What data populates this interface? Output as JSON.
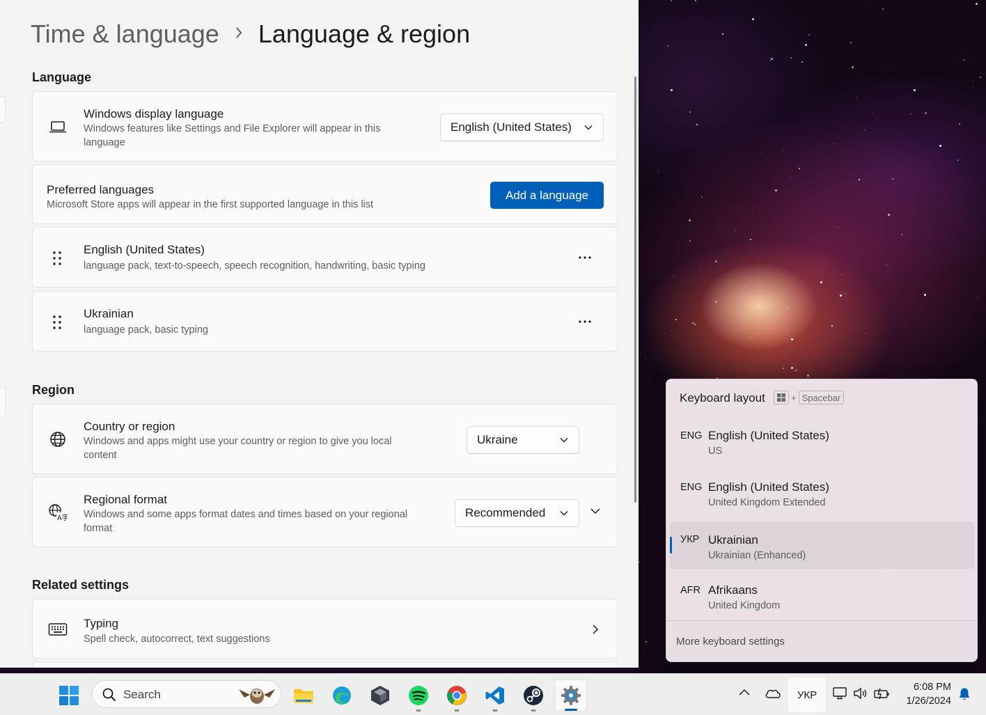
{
  "breadcrumb": {
    "parent": "Time & language",
    "current": "Language & region"
  },
  "language_section": {
    "title": "Language",
    "display_language": {
      "title": "Windows display language",
      "description_line1": "Windows features like Settings and File Explorer will appear in this",
      "description_line2": "language",
      "value": "English (United States)",
      "icon": "laptop-icon"
    },
    "preferred": {
      "title": "Preferred languages",
      "description": "Microsoft Store apps will appear in the first supported language in this list",
      "button": "Add a language"
    },
    "languages": [
      {
        "name": "English (United States)",
        "features": "language pack, text-to-speech, speech recognition, handwriting, basic typing"
      },
      {
        "name": "Ukrainian",
        "features": "language pack, basic typing"
      }
    ]
  },
  "region_section": {
    "title": "Region",
    "country": {
      "title": "Country or region",
      "description_line1": "Windows and apps might use your country or region to give you local",
      "description_line2": "content",
      "value": "Ukraine",
      "icon": "globe-icon"
    },
    "format": {
      "title": "Regional format",
      "description_line1": "Windows and some apps format dates and times based on your regional",
      "description_line2": "format",
      "value": "Recommended",
      "icon": "regional-format-icon"
    }
  },
  "related_section": {
    "title": "Related settings",
    "typing": {
      "title": "Typing",
      "description": "Spell check, autocorrect, text suggestions",
      "icon": "keyboard-icon"
    }
  },
  "keyboard_flyout": {
    "title": "Keyboard layout",
    "shortcut_plus": "+",
    "shortcut_key": "Spacebar",
    "items": [
      {
        "code": "ENG",
        "name": "English (United States)",
        "layout": "US",
        "active": false
      },
      {
        "code": "ENG",
        "name": "English (United States)",
        "layout": "United Kingdom Extended",
        "active": false
      },
      {
        "code": "УКР",
        "name": "Ukrainian",
        "layout": "Ukrainian (Enhanced)",
        "active": true
      },
      {
        "code": "AFR",
        "name": "Afrikaans",
        "layout": "United Kingdom",
        "active": false
      }
    ],
    "footer": "More keyboard settings"
  },
  "taskbar": {
    "search_placeholder": "Search",
    "apps": [
      "start-icon",
      "file-explorer-icon",
      "edge-icon",
      "obs-icon",
      "spotify-icon",
      "chrome-icon",
      "vscode-icon",
      "steam-icon",
      "settings-icon"
    ],
    "input_indicator": "УКР",
    "time": "6:08 PM",
    "date": "1/26/2024"
  },
  "colors": {
    "accent": "#005fb8",
    "settings_bg": "#f3f3f3",
    "card_bg": "#fbfbfb"
  }
}
